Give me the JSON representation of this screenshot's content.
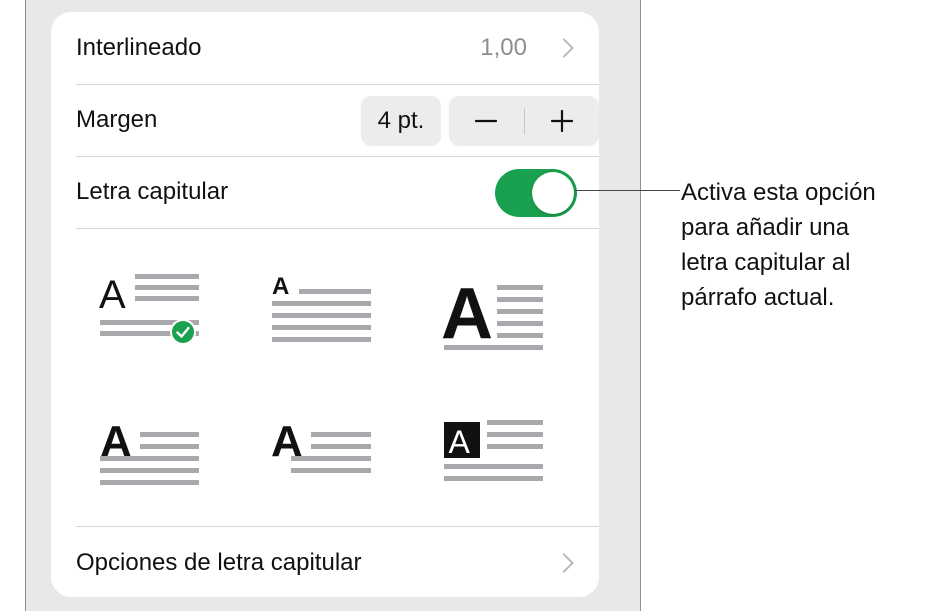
{
  "panel": {
    "line_spacing": {
      "label": "Interlineado",
      "value": "1,00"
    },
    "margin": {
      "label": "Margen",
      "value": "4 pt.",
      "decrement": "−",
      "increment": "+"
    },
    "drop_cap": {
      "label": "Letra capitular",
      "enabled": true
    },
    "styles": [
      {
        "id": "style-1",
        "glyph": "A",
        "selected": true
      },
      {
        "id": "style-2",
        "glyph": "A",
        "selected": false
      },
      {
        "id": "style-3",
        "glyph": "A",
        "selected": false
      },
      {
        "id": "style-4",
        "glyph": "A",
        "selected": false
      },
      {
        "id": "style-5",
        "glyph": "A",
        "selected": false
      },
      {
        "id": "style-6",
        "glyph": "A",
        "selected": false
      }
    ],
    "options_row": {
      "label": "Opciones de letra capitular"
    }
  },
  "callout": {
    "lines": [
      "Activa esta opción",
      "para añadir una",
      "letra capitular al",
      "párrafo actual."
    ]
  },
  "colors": {
    "toggle_on": "#1aa14f",
    "checkmark": "#1aa14f",
    "line_gray": "#a9a9ad",
    "panel_bg": "#e8e8ea"
  }
}
